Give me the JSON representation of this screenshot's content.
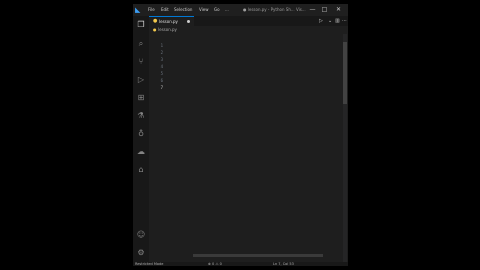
{
  "titlebar": {
    "menu": [
      "File",
      "Edit",
      "Selection",
      "View",
      "Go",
      "..."
    ],
    "title": "● lesson.py - Python Sh... Vis..."
  },
  "tabs": [
    {
      "label": "lesson.py",
      "icon": "python-file-icon"
    }
  ],
  "breadcrumb": {
    "file": "lesson.py"
  },
  "editor": {
    "line_numbers": [
      "1",
      "2",
      "3",
      "4",
      "5",
      "6",
      "7"
    ],
    "current_line": 7
  },
  "colors": {
    "accent": "#0078d4",
    "keyword": "#c586c0",
    "function": "#dcdcaa",
    "string": "#ce9178",
    "number": "#b5cea8"
  },
  "statusbar": {
    "left": "Restricted Mode",
    "center": "⊗ 0 ⚠ 0",
    "right": "Ln 7, Col 53"
  }
}
